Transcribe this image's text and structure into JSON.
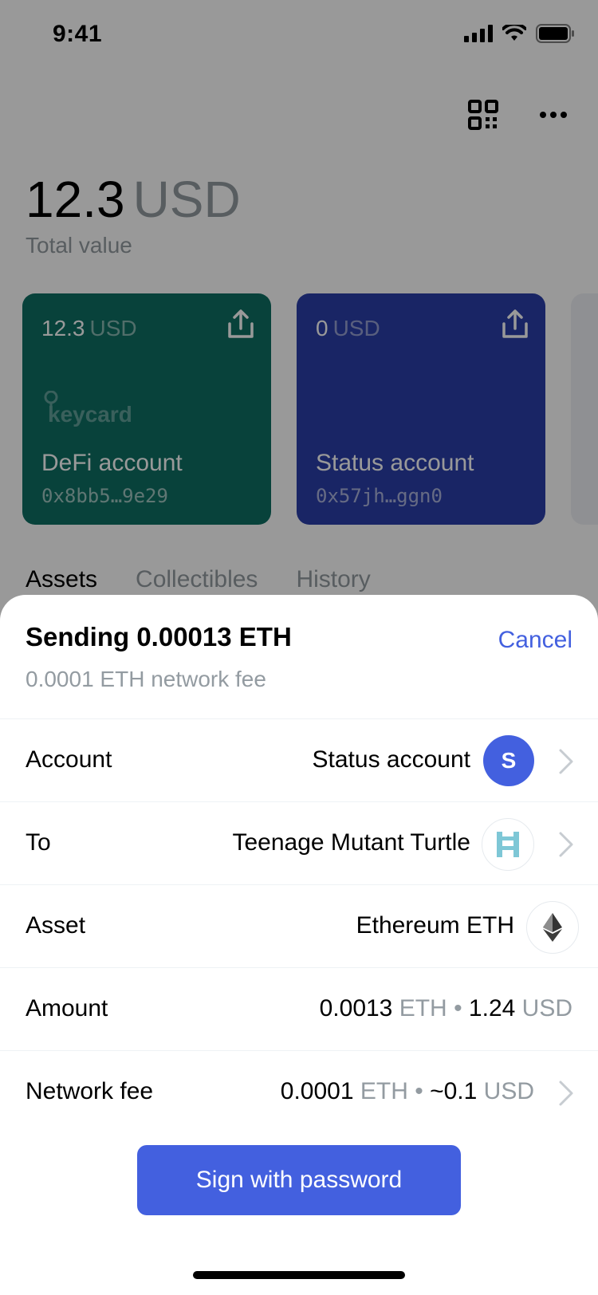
{
  "status_bar": {
    "time": "9:41"
  },
  "wallet": {
    "total_amount": "12.3",
    "total_currency": "USD",
    "total_label": "Total value",
    "accounts": [
      {
        "balance": "12.3",
        "currency": "USD",
        "brand": "keycard",
        "name": "DeFi account",
        "address": "0x8bb5…9e29",
        "color": "#0e6e63"
      },
      {
        "balance": "0",
        "currency": "USD",
        "brand": "",
        "name": "Status account",
        "address": "0x57jh…ggn0",
        "color": "#2b3fa8"
      }
    ],
    "tabs": [
      "Assets",
      "Collectibles",
      "History"
    ]
  },
  "sheet": {
    "title": "Sending 0.00013 ETH",
    "subtitle": "0.0001 ETH network fee",
    "cancel_label": "Cancel",
    "rows": {
      "account": {
        "label": "Account",
        "value": "Status account",
        "avatar_letter": "S"
      },
      "to": {
        "label": "To",
        "value": "Teenage Mutant Turtle"
      },
      "asset": {
        "label": "Asset",
        "value": "Ethereum ETH"
      },
      "amount": {
        "label": "Amount",
        "crypto": "0.0013",
        "crypto_unit": "ETH",
        "sep": "•",
        "fiat": "1.24",
        "fiat_unit": "USD"
      },
      "fee": {
        "label": "Network fee",
        "crypto": "0.0001",
        "crypto_unit": "ETH",
        "sep": "•",
        "fiat": "~0.1",
        "fiat_unit": "USD"
      }
    },
    "sign_button_label": "Sign with password"
  },
  "colors": {
    "accent": "#4360df",
    "secondary_text": "#939ba1",
    "defi_card": "#0e6e63",
    "status_card": "#2b3fa8"
  }
}
